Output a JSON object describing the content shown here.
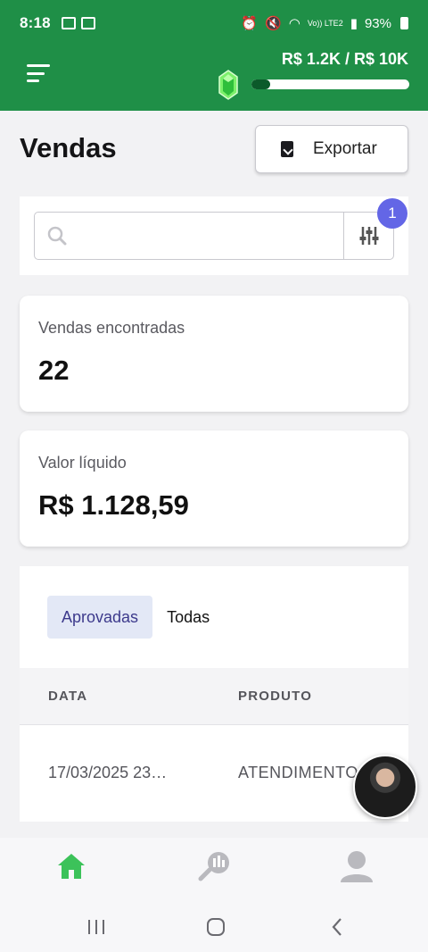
{
  "status_bar": {
    "time": "8:18",
    "battery": "93%",
    "signal_label": "Vo)) LTE2"
  },
  "header": {
    "goal_text": "R$ 1.2K / R$ 10K",
    "goal_progress": 0.12,
    "accent_color": "#1f8f47"
  },
  "page": {
    "title": "Vendas",
    "export_label": "Exportar"
  },
  "search": {
    "placeholder": "",
    "filter_badge": "1"
  },
  "stats": [
    {
      "label": "Vendas encontradas",
      "value": "22"
    },
    {
      "label": "Valor líquido",
      "value": "R$ 1.128,59"
    }
  ],
  "tabs": [
    {
      "label": "Aprovadas",
      "active": true
    },
    {
      "label": "Todas",
      "active": false
    }
  ],
  "table": {
    "columns": [
      "DATA",
      "PRODUTO"
    ],
    "rows": [
      {
        "data": "17/03/2025 23…",
        "produto": "ATENDIMENTO"
      }
    ]
  },
  "bottom_nav": [
    "home-icon",
    "analytics-icon",
    "profile-icon"
  ],
  "system_nav": [
    "recent-apps-icon",
    "home-circle-icon",
    "back-icon"
  ]
}
